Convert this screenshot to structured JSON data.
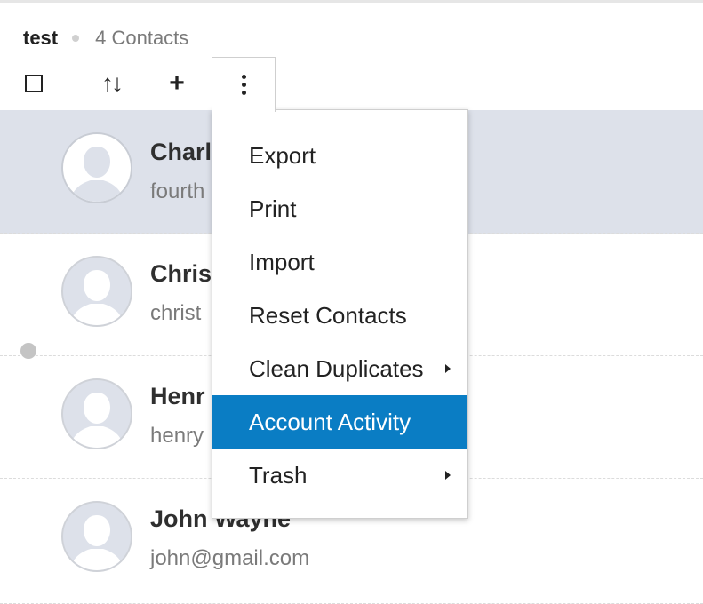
{
  "header": {
    "group_name": "test",
    "count": "4 Contacts"
  },
  "toolbar": {
    "select_all": "checkbox",
    "sort": "↑↓",
    "add": "+",
    "more": "more-vertical"
  },
  "contacts": [
    {
      "name": "Charl",
      "email": "fourth",
      "selected": true
    },
    {
      "name": "Chris",
      "email": "christ",
      "selected": false
    },
    {
      "name": "Henr",
      "email": "henry",
      "selected": false
    },
    {
      "name": "John Wayne",
      "email": "john@gmail.com",
      "selected": false
    }
  ],
  "menu": {
    "items": [
      {
        "label": "Export",
        "submenu": false
      },
      {
        "label": "Print",
        "submenu": false
      },
      {
        "label": "Import",
        "submenu": false
      },
      {
        "label": "Reset Contacts",
        "submenu": false
      },
      {
        "label": "Clean Duplicates",
        "submenu": true
      },
      {
        "label": "Account Activity",
        "submenu": false,
        "active": true
      },
      {
        "label": "Trash",
        "submenu": true
      }
    ]
  },
  "colors": {
    "accent": "#0a7dc4",
    "selected_row": "#dde1ea",
    "presence": "#c4c4c4"
  }
}
